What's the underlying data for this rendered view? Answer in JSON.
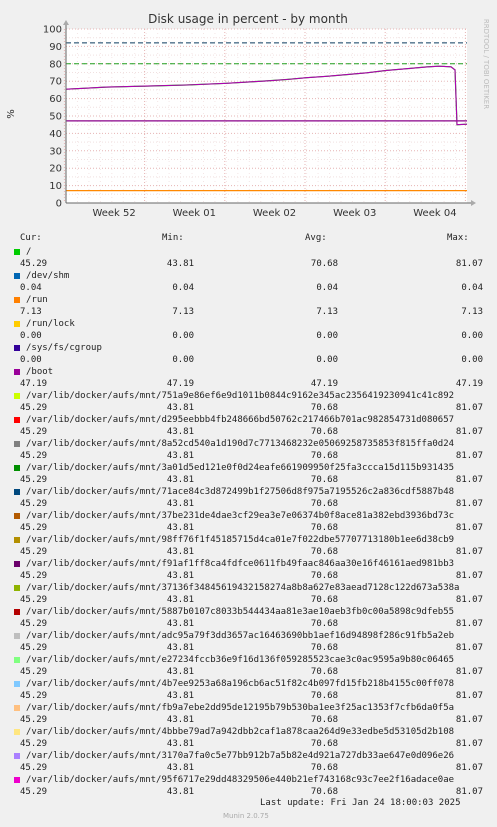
{
  "chart_data": {
    "type": "line",
    "title": "Disk usage in percent - by month",
    "ylabel": "%",
    "side_label": "RRDTOOL / TOBI OETIKER",
    "ylim": [
      0,
      100
    ],
    "yticks": [
      0,
      10,
      20,
      30,
      40,
      50,
      60,
      70,
      80,
      90,
      100
    ],
    "xticks": [
      "Week 52",
      "Week 01",
      "Week 02",
      "Week 03",
      "Week 04"
    ],
    "thresholds": {
      "warning": 80,
      "critical": 92
    },
    "grid": true,
    "series": [
      {
        "name": "/",
        "color": "#00cc00",
        "points": [
          [
            0,
            65.4
          ],
          [
            0.05,
            66.0
          ],
          [
            0.1,
            66.6
          ],
          [
            0.2,
            67.2
          ],
          [
            0.3,
            67.8
          ],
          [
            0.4,
            68.8
          ],
          [
            0.5,
            70.2
          ],
          [
            0.55,
            71.0
          ],
          [
            0.6,
            72.0
          ],
          [
            0.65,
            72.8
          ],
          [
            0.7,
            73.8
          ],
          [
            0.75,
            74.8
          ],
          [
            0.8,
            76.2
          ],
          [
            0.85,
            77.2
          ],
          [
            0.9,
            78.2
          ],
          [
            0.93,
            78.6
          ],
          [
            0.96,
            78.3
          ],
          [
            0.97,
            76.5
          ],
          [
            0.975,
            45.0
          ],
          [
            1.0,
            45.29
          ]
        ]
      },
      {
        "name": "/boot",
        "color": "#880088",
        "points": [
          [
            0,
            47.19
          ],
          [
            1.0,
            47.19
          ]
        ]
      },
      {
        "name": "/run",
        "color": "#ff8800",
        "points": [
          [
            0,
            7.13
          ],
          [
            1.0,
            7.13
          ]
        ]
      }
    ]
  },
  "legend": {
    "headers": {
      "cur": "Cur:",
      "min": "Min:",
      "avg": "Avg:",
      "max": "Max:"
    },
    "entries": [
      {
        "name": "/",
        "color": "#00cc00",
        "cur": "45.29",
        "min": "43.81",
        "avg": "70.68",
        "max": "81.07"
      },
      {
        "name": "/dev/shm",
        "color": "#0066b3",
        "cur": "0.04",
        "min": "0.04",
        "avg": "0.04",
        "max": "0.04"
      },
      {
        "name": "/run",
        "color": "#ff8000",
        "cur": "7.13",
        "min": "7.13",
        "avg": "7.13",
        "max": "7.13"
      },
      {
        "name": "/run/lock",
        "color": "#ffcc00",
        "cur": "0.00",
        "min": "0.00",
        "avg": "0.00",
        "max": "0.00"
      },
      {
        "name": "/sys/fs/cgroup",
        "color": "#330099",
        "cur": "0.00",
        "min": "0.00",
        "avg": "0.00",
        "max": "0.00"
      },
      {
        "name": "/boot",
        "color": "#990099",
        "cur": "47.19",
        "min": "47.19",
        "avg": "47.19",
        "max": "47.19"
      },
      {
        "name": "/var/lib/docker/aufs/mnt/751a9e86ef6e9d1011b0844c9162e345ac2356419230941c41c892",
        "color": "#ccff00",
        "cur": "45.29",
        "min": "43.81",
        "avg": "70.68",
        "max": "81.07"
      },
      {
        "name": "/var/lib/docker/aufs/mnt/d295eebbb4fb248666bd50762c217466b701ac982854731d080657",
        "color": "#ff0000",
        "cur": "45.29",
        "min": "43.81",
        "avg": "70.68",
        "max": "81.07"
      },
      {
        "name": "/var/lib/docker/aufs/mnt/8a52cd540a1d190d7c7713468232e05069258735853f815ffa0d24",
        "color": "#808080",
        "cur": "45.29",
        "min": "43.81",
        "avg": "70.68",
        "max": "81.07"
      },
      {
        "name": "/var/lib/docker/aufs/mnt/3a01d5ed121e0f0d24eafe661909950f25fa3ccca15d115b931435",
        "color": "#008f00",
        "cur": "45.29",
        "min": "43.81",
        "avg": "70.68",
        "max": "81.07"
      },
      {
        "name": "/var/lib/docker/aufs/mnt/71ace84c3d872499b1f27506d8f975a7195526c2a836cdf5887b48",
        "color": "#00487d",
        "cur": "45.29",
        "min": "43.81",
        "avg": "70.68",
        "max": "81.07"
      },
      {
        "name": "/var/lib/docker/aufs/mnt/37be231de4dae3cf29ea3e7e06374b0f8ace81a382ebd3936bd73c",
        "color": "#b35a00",
        "cur": "45.29",
        "min": "43.81",
        "avg": "70.68",
        "max": "81.07"
      },
      {
        "name": "/var/lib/docker/aufs/mnt/98ff76f1f45185715d4ca01e7f022dbe57707713180b1ee6d38cb9",
        "color": "#b38f00",
        "cur": "45.29",
        "min": "43.81",
        "avg": "70.68",
        "max": "81.07"
      },
      {
        "name": "/var/lib/docker/aufs/mnt/f91af1ff8ca4fdfce0611fb49faac846aa30e16f46161aed981bb3",
        "color": "#6b006b",
        "cur": "45.29",
        "min": "43.81",
        "avg": "70.68",
        "max": "81.07"
      },
      {
        "name": "/var/lib/docker/aufs/mnt/37136f34845619432158274a8b8a627e83aead7128c122d673a538a",
        "color": "#8fb300",
        "cur": "45.29",
        "min": "43.81",
        "avg": "70.68",
        "max": "81.07"
      },
      {
        "name": "/var/lib/docker/aufs/mnt/5887b0107c8033b544434aa81e3ae10aeb3fb0c00a5898c9dfeb55",
        "color": "#b30000",
        "cur": "45.29",
        "min": "43.81",
        "avg": "70.68",
        "max": "81.07"
      },
      {
        "name": "/var/lib/docker/aufs/mnt/adc95a79f3dd3657ac16463690bb1aef16d94898f286c91fb5a2eb",
        "color": "#bebebe",
        "cur": "45.29",
        "min": "43.81",
        "avg": "70.68",
        "max": "81.07"
      },
      {
        "name": "/var/lib/docker/aufs/mnt/e27234fccb36e9f16d136f059285523cae3c0ac9595a9b80c06465",
        "color": "#80ff80",
        "cur": "45.29",
        "min": "43.81",
        "avg": "70.68",
        "max": "81.07"
      },
      {
        "name": "/var/lib/docker/aufs/mnt/4b7ee9253a68a196cb6ac51f82c4b097fd15fb218b4155c00ff078",
        "color": "#80c9ff",
        "cur": "45.29",
        "min": "43.81",
        "avg": "70.68",
        "max": "81.07"
      },
      {
        "name": "/var/lib/docker/aufs/mnt/fb9a7ebe2dd95de12195b79b530ba1ee3f25ac1353f7cfb6da0f5a",
        "color": "#ffc080",
        "cur": "45.29",
        "min": "43.81",
        "avg": "70.68",
        "max": "81.07"
      },
      {
        "name": "/var/lib/docker/aufs/mnt/4bbbe79ad7a942dbb2caf1a878caa264d9e33edbe5d53105d2b108",
        "color": "#ffe680",
        "cur": "45.29",
        "min": "43.81",
        "avg": "70.68",
        "max": "81.07"
      },
      {
        "name": "/var/lib/docker/aufs/mnt/3170a7fa0c5e77bb912b7a5b82e4d921a727db33ae647e0d096e26",
        "color": "#aa80ff",
        "cur": "45.29",
        "min": "43.81",
        "avg": "70.68",
        "max": "81.07"
      },
      {
        "name": "/var/lib/docker/aufs/mnt/95f6717e29dd48329506e440b21ef743168c93c7ee2f16adace0ae",
        "color": "#ee00cc",
        "cur": "45.29",
        "min": "43.81",
        "avg": "70.68",
        "max": "81.07"
      }
    ]
  },
  "footer": {
    "last_update": "Last update: Fri Jan 24 18:00:03 2025",
    "version": "Munin 2.0.75"
  }
}
